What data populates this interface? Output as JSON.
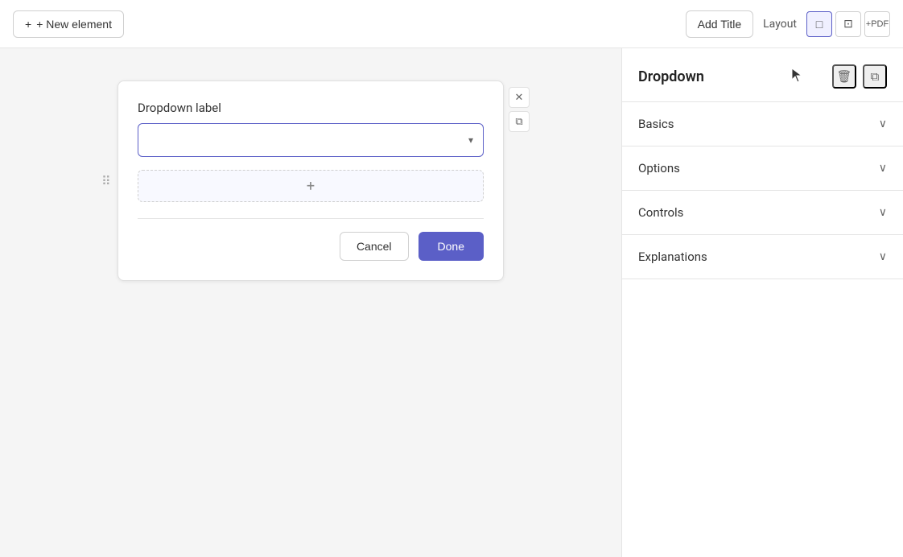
{
  "toolbar": {
    "new_element_label": "+ New element",
    "add_title_label": "Add Title",
    "layout_label": "Layout",
    "layout_icon_square": "☐",
    "layout_icon_table": "⊞",
    "layout_icon_pdf": "+PDF"
  },
  "canvas": {
    "dropdown": {
      "label": "Dropdown label",
      "placeholder": "",
      "add_item_icon": "+"
    },
    "actions": {
      "cancel_label": "Cancel",
      "done_label": "Done"
    }
  },
  "right_panel": {
    "title": "Dropdown",
    "delete_icon": "🗑",
    "copy_icon": "⧉",
    "sections": [
      {
        "id": "basics",
        "label": "Basics"
      },
      {
        "id": "options",
        "label": "Options"
      },
      {
        "id": "controls",
        "label": "Controls"
      },
      {
        "id": "explanations",
        "label": "Explanations"
      }
    ]
  }
}
